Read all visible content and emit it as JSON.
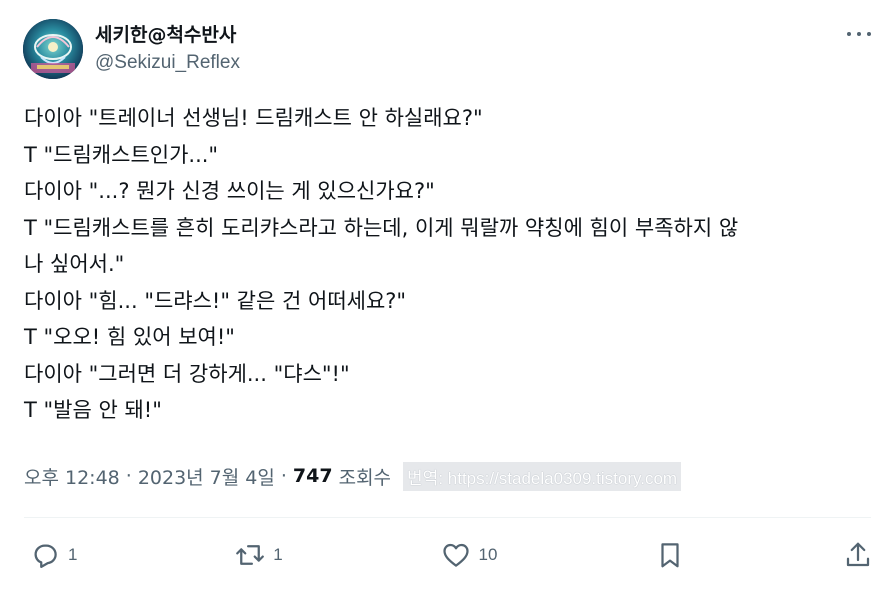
{
  "author": {
    "display_name": "세키한@척수반사",
    "handle": "@Sekizui_Reflex",
    "avatar_icon": "avatar-image"
  },
  "more_icon": "more-horizontal-icon",
  "tweet": {
    "lines": [
      "다이아 \"트레이너 선생님! 드림캐스트 안 하실래요?\"",
      "T \"드림캐스트인가...\"",
      "다이아 \"...? 뭔가 신경 쓰이는 게 있으신가요?\"",
      "T \"드림캐스트를 흔히 도리캬스라고 하는데, 이게 뭐랄까 약칭에 힘이 부족하지 않",
      "나 싶어서.\"",
      "다이아 \"힘... \"드랴스!\" 같은 건 어떠세요?\"",
      "T \"오오! 힘 있어 보여!\"",
      "다이아 \"그러면 더 강하게... \"댜스\"!\"",
      "T \"발음 안 돼!\""
    ]
  },
  "meta": {
    "time": "오후 12:48",
    "separator": "·",
    "date": "2023년 7월 4일",
    "views_count": "747",
    "views_label": "조회수",
    "watermark": "번역: https://stadela0309.tistory.com"
  },
  "actions": {
    "reply_count": "1",
    "retweet_count": "1",
    "like_count": "10",
    "icon_color": "#536471"
  }
}
